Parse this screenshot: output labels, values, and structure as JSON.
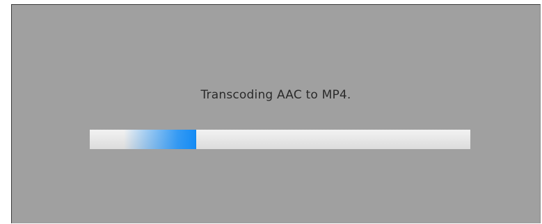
{
  "dialog": {
    "status_text": "Transcoding AAC to MP4.",
    "progress": {
      "indeterminate": true,
      "segment_start_fraction": 0.09,
      "segment_end_fraction": 0.28,
      "accent_color": "#158CF5"
    }
  }
}
